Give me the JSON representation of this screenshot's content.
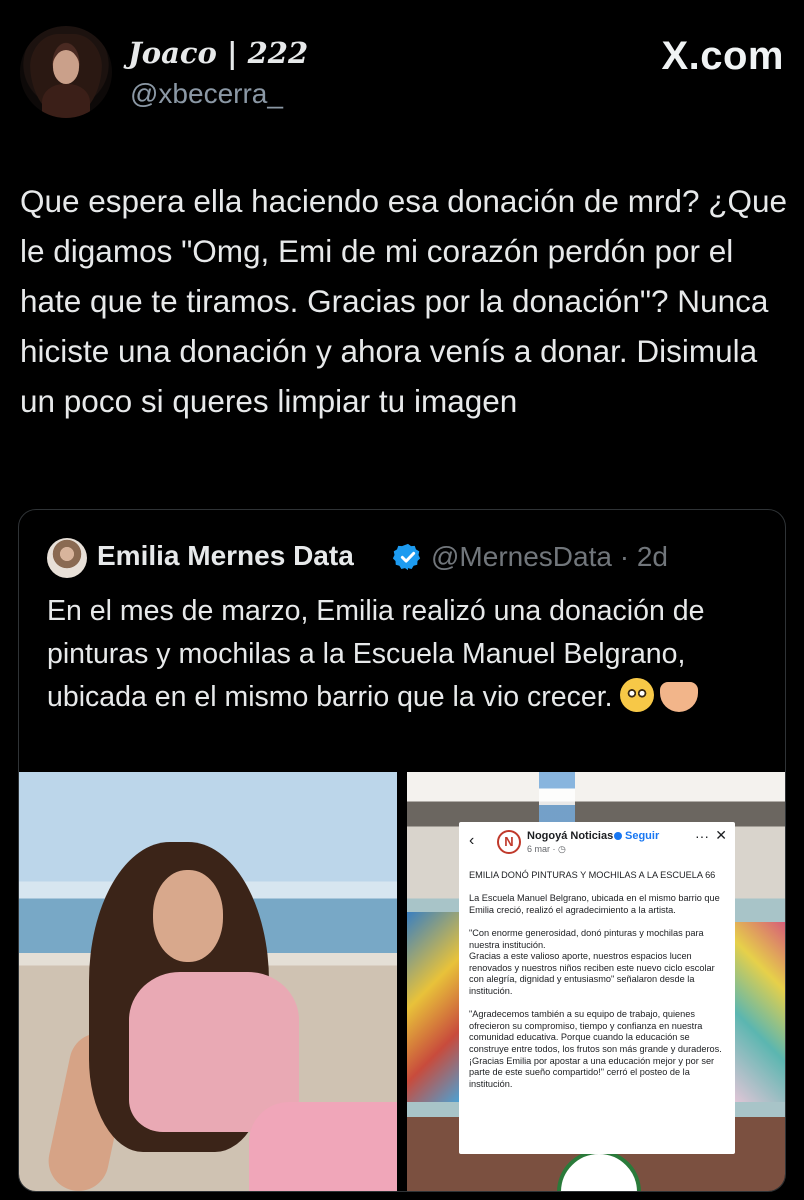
{
  "tweet": {
    "display_name": "Joaco | 222",
    "handle": "@xbecerra_",
    "site_label": "X.com",
    "text": "Que espera ella haciendo esa donación de mrd? ¿Que le digamos \"Omg, Emi de mi corazón perdón por el hate que te tiramos. Gracias por la donación\"? Nunca hiciste una donación y ahora venís a donar. Disimula un poco si queres limpiar tu imagen"
  },
  "quote": {
    "display_name": "Emilia Mernes Data",
    "verified": true,
    "handle_time": "@MernesData · 2d",
    "text": "En el mes de marzo, Emilia realizó una donación de pinturas y mochilas a la Escuela Manuel Belgrano, ubicada en el mismo barrio que la vio crecer.",
    "emojis": [
      "pleading-face-emoji",
      "heart-hands-emoji"
    ],
    "fb_post": {
      "back": "‹",
      "page_name": "Nogoyá Noticias",
      "follow": "Seguir",
      "date": "6 mar · ◷",
      "more": "···",
      "close": "✕",
      "body": "EMILIA DONÓ PINTURAS Y MOCHILAS A LA ESCUELA 66\n\nLa Escuela Manuel Belgrano, ubicada en el mismo barrio que Emilia creció, realizó el agradecimiento a la artista.\n\n\"Con enorme generosidad, donó pinturas y mochilas para nuestra institución.\nGracias a este valioso aporte, nuestros espacios lucen renovados y nuestros niños reciben este nuevo ciclo escolar con alegría, dignidad y entusiasmo\" señalaron desde la institución.\n\n\"Agradecemos también a su equipo de trabajo, quienes ofrecieron su compromiso, tiempo y confianza en nuestra comunidad educativa. Porque cuando la educación se construye entre todos, los frutos son más grande y duraderos. ¡Gracias Emilia por apostar a una educación mejor y por ser parte de este sueño compartido!\" cerró el posteo de la institución."
    }
  },
  "colors": {
    "background": "#000000",
    "text_primary": "#e7e9ea",
    "text_secondary": "#71767b",
    "verified_blue": "#1d9bf0",
    "border": "#2f3336"
  }
}
